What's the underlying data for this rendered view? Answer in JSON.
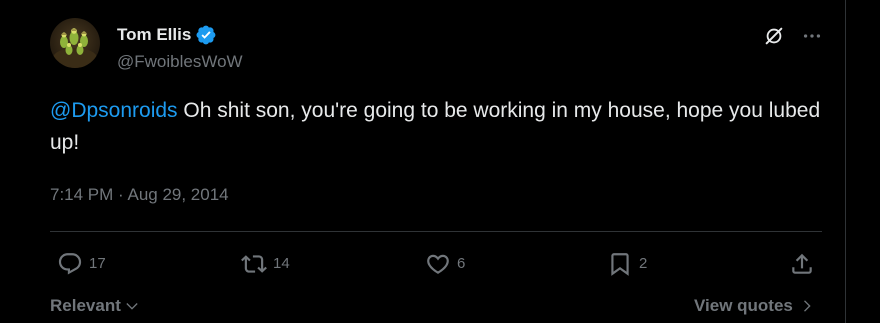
{
  "author": {
    "display_name": "Tom Ellis",
    "handle": "@FwoiblesWoW",
    "verified": true
  },
  "tweet": {
    "mention": "@Dpsonroids",
    "text": " Oh shit son, you're going to be working in my house, hope you lubed up!",
    "timestamp": "7:14 PM · Aug 29, 2014"
  },
  "actions": {
    "replies": "17",
    "reposts": "14",
    "likes": "6",
    "bookmarks": "2"
  },
  "footer": {
    "sort_label": "Relevant",
    "view_quotes_label": "View quotes"
  },
  "colors": {
    "background": "#000000",
    "text": "#e7e9ea",
    "muted": "#71767b",
    "accent": "#1d9bf0",
    "divider": "#2f3336"
  },
  "icons": {
    "verified": "verified-badge-icon",
    "grok": "grok-icon",
    "more": "more-horizontal-icon",
    "reply": "reply-icon",
    "repost": "repost-icon",
    "like": "heart-icon",
    "bookmark": "bookmark-icon",
    "share": "share-icon",
    "sort": "chevron-down-icon",
    "view_quotes": "chevron-right-icon"
  }
}
